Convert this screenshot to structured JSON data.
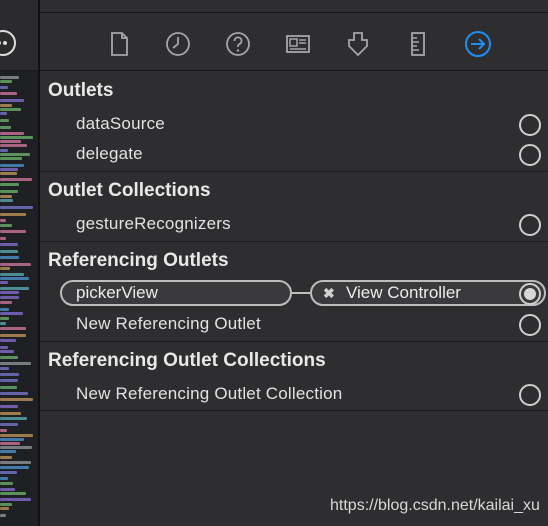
{
  "toolbar": {
    "icons": [
      "file-inspector-icon",
      "quick-help-clock-icon",
      "help-question-icon",
      "identity-inspector-icon",
      "attributes-inspector-icon",
      "size-inspector-ruler-icon",
      "connections-inspector-arrow-icon"
    ],
    "active_color": "#1f8ef1"
  },
  "sections": {
    "outlets": {
      "title": "Outlets",
      "items": [
        "dataSource",
        "delegate"
      ]
    },
    "outlet_collections": {
      "title": "Outlet Collections",
      "items": [
        "gestureRecognizers"
      ]
    },
    "referencing_outlets": {
      "title": "Referencing Outlets",
      "connection": {
        "outlet": "pickerView",
        "remove_symbol": "✖",
        "target": "View Controller"
      },
      "new_item": "New Referencing Outlet"
    },
    "referencing_outlet_collections": {
      "title": "Referencing Outlet Collections",
      "new_item": "New Referencing Outlet Collection"
    }
  },
  "watermark": "https://blog.csdn.net/kailai_xu"
}
